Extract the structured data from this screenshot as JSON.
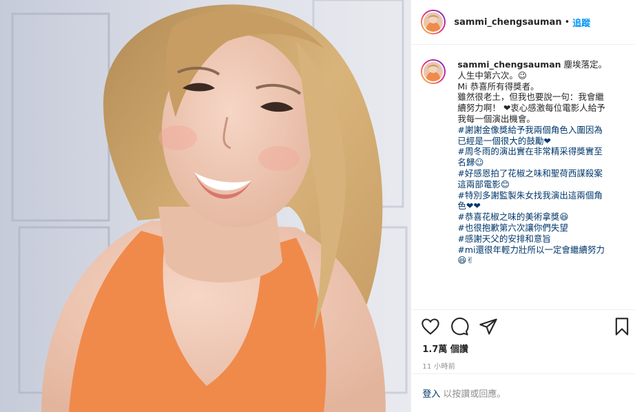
{
  "post": {
    "username": "sammi_chengsauman",
    "dot": "•",
    "follow_label": "追蹤",
    "caption_title": "塵埃落定。",
    "caption_lines": [
      "人生中第六次。😉",
      "Mi 恭喜所有得獎者。",
      "雖然很老土，但我也要說一句：我會繼",
      "續努力啊！ ❤衷心感激每位電影人給予",
      "我每一個演出機會。"
    ],
    "hashtag_lines": [
      "#謝謝金像獎給予我兩個角色入圍因為",
      "已經是一個很大的鼓勵❤",
      "#周冬雨的演出實在非常精采得獎實至",
      "名歸☺",
      "#好感恩拍了花椒之味和聖荷西謀殺案",
      "這兩部電影😊",
      "#特別多謝監製朱女找我演出這兩個角",
      "色❤❤",
      "#恭喜花椒之味的美術拿獎😆",
      "#也很抱歉第六次讓你們失望",
      "#感謝天父的安排和意旨",
      "#mi還很年輕力壯所以一定會繼續努力",
      "😆✌"
    ],
    "views": "1.7萬 個讚",
    "time": "11 小時前",
    "login_link": "登入",
    "login_text": "以按讚或回應。"
  },
  "icons": {
    "like": "heart-icon",
    "comment": "comment-icon",
    "share": "send-icon",
    "save": "bookmark-icon"
  },
  "colors": {
    "accent": "#0095f6",
    "hashtag": "#00376b",
    "muted": "#8e8e8e",
    "top_color": "#f08a4b"
  }
}
